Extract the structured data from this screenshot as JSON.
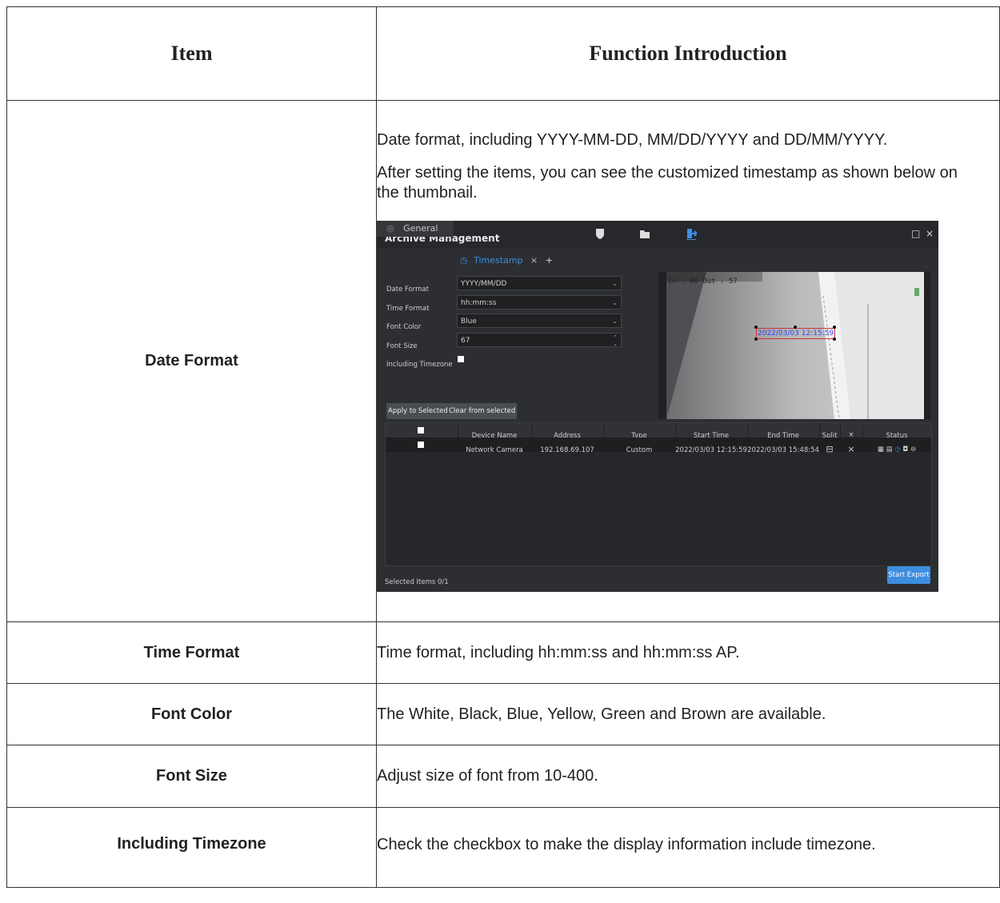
{
  "header": {
    "item": "Item",
    "function": "Function Introduction"
  },
  "rows": [
    {
      "item": "Date Format",
      "text1": "Date format, including YYYY-MM-DD, MM/DD/YYYY and DD/MM/YYYY.",
      "text2": "After setting the items, you can see the customized timestamp as shown below on the thumbnail."
    },
    {
      "item": "Time Format",
      "text": "Time format, including hh:mm:ss and hh:mm:ss AP."
    },
    {
      "item": "Font Color",
      "text": "The White, Black, Blue, Yellow, Green and Brown are available."
    },
    {
      "item": "Font Size",
      "text": "Adjust size of font from 10-400."
    },
    {
      "item": "Including Timezone",
      "text": "Check the checkbox to make the display information include timezone."
    }
  ],
  "app": {
    "title": "Archive Management",
    "window_controls": [
      "□",
      "×"
    ],
    "tabs": {
      "general": "General",
      "timestamp": "Timestamp",
      "close": "×",
      "add": "+"
    },
    "form": {
      "date_format_label": "Date Format",
      "date_format_value": "YYYY/MM/DD",
      "time_format_label": "Time Format",
      "time_format_value": "hh:mm:ss",
      "font_color_label": "Font Color",
      "font_color_value": "Blue",
      "font_size_label": "Font Size",
      "font_size_value": "67",
      "timezone_label": "Including Timezone"
    },
    "preview": {
      "osd": "In : 86   Out : 57",
      "timestamp": "2022/03/03 12:15:59",
      "timestamp_color": "#3344ff"
    },
    "buttons": {
      "apply": "Apply to Selected",
      "clear": "Clear from selected",
      "export": "Start Export"
    },
    "grid": {
      "headers": [
        "Device Name",
        "Address",
        "Type",
        "Start Time",
        "End Time",
        "Split",
        "×",
        "Status"
      ],
      "row": {
        "device": "Network Camera",
        "address": "192.168.69.107",
        "type": "Custom",
        "start": "2022/03/03 12:15:59",
        "end": "2022/03/03 15:48:54",
        "split": "⊟",
        "x": "×"
      }
    },
    "footer": "Selected Items  0/1"
  }
}
